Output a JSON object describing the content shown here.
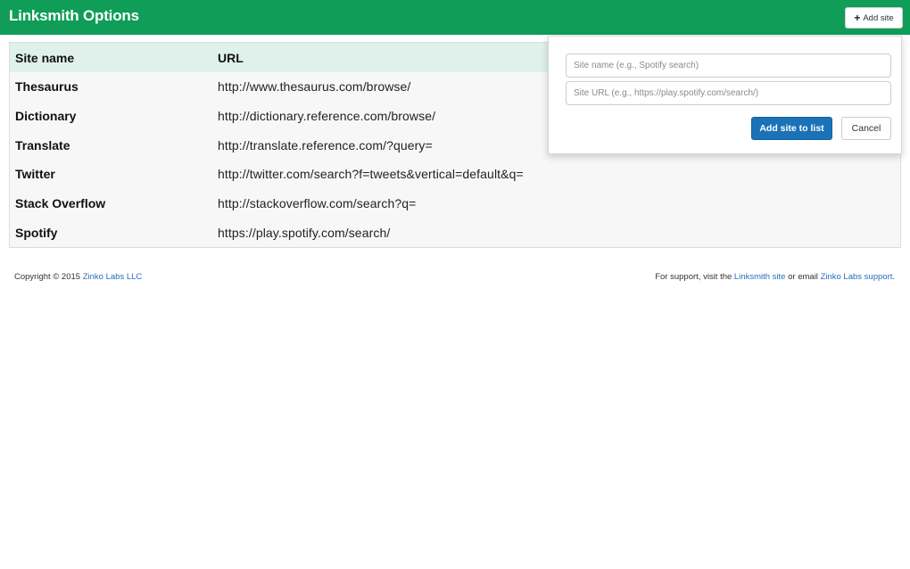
{
  "header": {
    "title": "Linksmith Options",
    "add_site_icon": "plus-icon",
    "add_site_label": "Add site",
    "background": "#0f9d58"
  },
  "table": {
    "columns": [
      "Site name",
      "URL"
    ],
    "rows": [
      {
        "name": "Thesaurus",
        "url": "http://www.thesaurus.com/browse/"
      },
      {
        "name": "Dictionary",
        "url": "http://dictionary.reference.com/browse/"
      },
      {
        "name": "Translate",
        "url": "http://translate.reference.com/?query="
      },
      {
        "name": "Twitter",
        "url": "http://twitter.com/search?f=tweets&vertical=default&q="
      },
      {
        "name": "Stack Overflow",
        "url": "http://stackoverflow.com/search?q="
      },
      {
        "name": "Spotify",
        "url": "https://play.spotify.com/search/"
      }
    ]
  },
  "popover": {
    "site_name_value": "",
    "site_name_placeholder": "Site name (e.g., Spotify search)",
    "site_url_value": "",
    "site_url_placeholder": "Site URL (e.g., https://play.spotify.com/search/)",
    "add_label": "Add site to list",
    "cancel_label": "Cancel",
    "add_button_color": "#1a73b8"
  },
  "footer": {
    "copyright_prefix": "Copyright © 2015 ",
    "copyright_link": "Zinko Labs LLC",
    "support_prefix": "For support, visit the ",
    "support_link1": "Linksmith site",
    "support_mid": " or email ",
    "support_link2": "Zinko Labs support",
    "support_suffix": "."
  }
}
